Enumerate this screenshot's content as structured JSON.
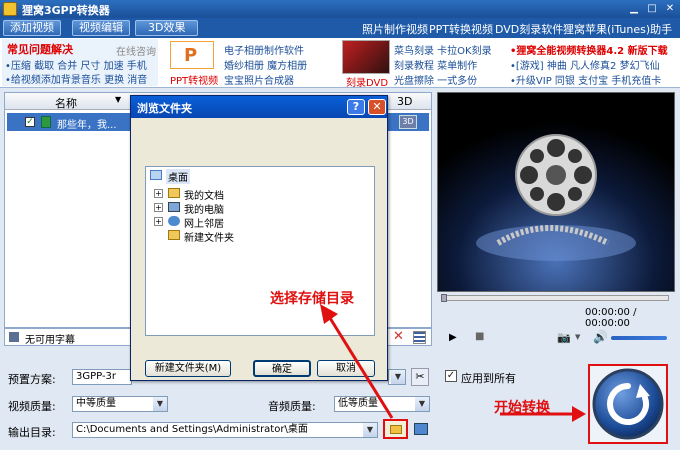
{
  "app": {
    "title": "狸窝3GPP转换器"
  },
  "toolbar": {
    "add_video": "添加视频",
    "edit_video": "视频编辑",
    "effect_3d": "3D效果",
    "links": [
      "照片制作视频",
      "PPT转换视频",
      "DVD刻录软件",
      "狸窝苹果(iTunes)助手"
    ]
  },
  "banner": {
    "faq_title": "常见问题解决",
    "faq_online": "在线咨询",
    "faq_line1": "•压缩 截取 合并 尺寸 加速 手机",
    "faq_line2": "•给视频添加背景音乐 更换 消音",
    "ppt_label": "PPT转视频",
    "ppt_icon_text": "P",
    "mid_lines": [
      "电子相册制作软件",
      "婚纱相册 魔方相册",
      "宝宝照片合成器"
    ],
    "dvd_label": "刻录DVD",
    "dvd_lines": [
      "菜鸟刻录 卡拉OK刻录",
      "刻录教程 菜单制作",
      "光盘擦除 一式多份"
    ],
    "right_line1": "•狸窝全能视频转换器4.2 新版下载",
    "right_line2": "•[游戏] 神曲 凡人修真2 梦幻飞仙",
    "right_line3": "•升级VIP 同银 支付宝 手机充值卡"
  },
  "list": {
    "col_name": "名称",
    "col_3d": "3D",
    "row1_name": "那些年，我..."
  },
  "subtitle": {
    "value": "无可用字幕"
  },
  "player": {
    "time": "00:00:00 / 00:00:00"
  },
  "settings": {
    "preset_label": "预置方案:",
    "preset_value": "3GPP-3r",
    "apply_all": "应用到所有",
    "video_quality_label": "视频质量:",
    "video_quality_value": "中等质量",
    "audio_quality_label": "音频质量:",
    "audio_quality_value": "低等质量",
    "output_label": "输出目录:",
    "output_path": "C:\\Documents and Settings\\Administrator\\桌面"
  },
  "dialog": {
    "title": "浏览文件夹",
    "help": "?",
    "close": "✕",
    "tree": {
      "root": "桌面",
      "items": [
        "我的文档",
        "我的电脑",
        "网上邻居",
        "新建文件夹"
      ]
    },
    "new_folder": "新建文件夹(M)",
    "ok": "确定",
    "cancel": "取消"
  },
  "annotations": {
    "choose_dir": "选择存储目录",
    "start_convert": "开始转换"
  },
  "colors": {
    "annot_red": "#e01010",
    "accent_blue": "#1e5aa8"
  }
}
